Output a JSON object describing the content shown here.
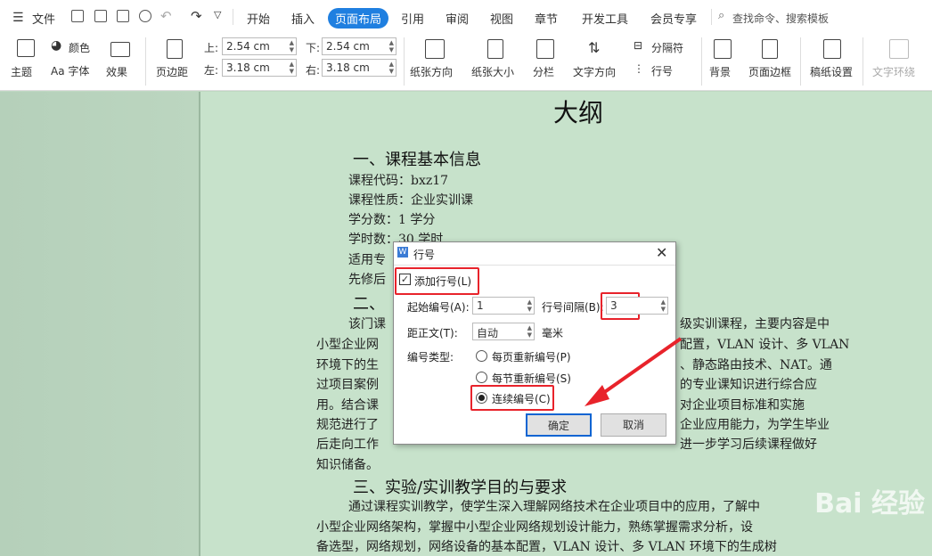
{
  "tabbar": {
    "file_menu": "文件",
    "tabs": [
      "开始",
      "插入",
      "页面布局",
      "引用",
      "审阅",
      "视图",
      "章节",
      "开发工具",
      "会员专享"
    ],
    "active_tab": "页面布局",
    "search_placeholder": "查找命令、搜索模板"
  },
  "ribbon": {
    "theme": "主题",
    "colors": "颜色",
    "fonts": "Aa 字体",
    "effects": "效果",
    "margins": "页边距",
    "margin_top_label": "上:",
    "margin_top_value": "2.54 cm",
    "margin_bottom_label": "下:",
    "margin_bottom_value": "2.54 cm",
    "margin_left_label": "左:",
    "margin_left_value": "3.18 cm",
    "margin_right_label": "右:",
    "margin_right_value": "3.18 cm",
    "orientation": "纸张方向",
    "size": "纸张大小",
    "columns": "分栏",
    "text_direction": "文字方向",
    "breaks": "分隔符",
    "line_numbers": "行号",
    "background": "背景",
    "page_borders": "页面边框",
    "manuscript": "稿纸设置",
    "wrap_text": "文字环绕"
  },
  "document": {
    "title": "大纲",
    "section1": "一、课程基本信息",
    "lines1": [
      "课程代码：bxz17",
      "课程性质：企业实训课",
      "学分数：1 学分",
      "学时数：30 学时",
      "适用专",
      "先修后"
    ],
    "section2_fragment": "二、",
    "para2": [
      "该门课",
      "小型企业网",
      "环境下的生",
      "过项目案例",
      "用。结合课",
      "规范进行了",
      "后走向工作",
      "知识储备。"
    ],
    "para2_right": [
      "级实训课程，主要内容是中",
      "配置，VLAN 设计、多 VLAN",
      "、静态路由技术、NAT。通",
      "的专业课知识进行综合应",
      "对企业项目标准和实施",
      "企业应用能力，为学生毕业",
      "进一步学习后续课程做好"
    ],
    "section3": "三、实验/实训教学目的与要求",
    "para3": [
      "通过课程实训教学，使学生深入理解网络技术在企业项目中的应用，了解中",
      "小型企业网络架构，掌握中小型企业网络规划设计能力，熟练掌握需求分析，设",
      "备选型，网络规划，网络设备的基本配置，VLAN 设计、多 VLAN 环境下的生成树"
    ]
  },
  "dialog": {
    "title": "行号",
    "add_line_numbers": "添加行号(L)",
    "start_at_label": "起始编号(A):",
    "start_at_value": "1",
    "count_by_label": "行号间隔(B):",
    "count_by_value": "3",
    "from_text_label": "距正文(T):",
    "from_text_value": "自动",
    "from_text_unit": "毫米",
    "numbering_label": "编号类型:",
    "restart_page": "每页重新编号(P)",
    "restart_section": "每节重新编号(S)",
    "continuous": "连续编号(C)",
    "ok": "确定",
    "cancel": "取消"
  },
  "watermark": "Bai 经验",
  "colors": {
    "accent": "#1f7fe0",
    "highlight": "#e8232b",
    "page": "#c7e2cb"
  }
}
